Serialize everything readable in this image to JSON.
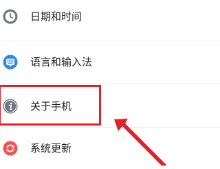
{
  "settings": {
    "items": [
      {
        "label": "日期和时间",
        "icon": "clock-icon",
        "color": "#6f7683"
      },
      {
        "label": "语言和输入法",
        "icon": "keyboard-icon",
        "color": "#2f8ae5"
      },
      {
        "label": "关于手机",
        "icon": "info-icon",
        "color": "#6f7683"
      },
      {
        "label": "系统更新",
        "icon": "refresh-icon",
        "color": "#ef5350"
      }
    ]
  },
  "annotation": {
    "highlight_color": "#e0202b",
    "arrow_color": "#e0202b"
  }
}
